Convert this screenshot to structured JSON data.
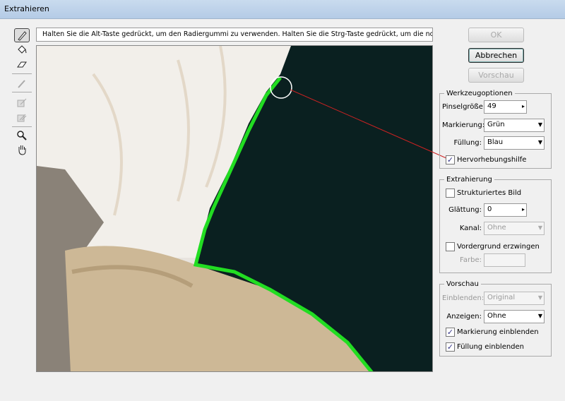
{
  "window": {
    "title": "Extrahieren"
  },
  "hint": "Halten Sie die Alt-Taste gedrückt, um den Radiergummi zu verwenden. Halten Sie die Strg-Taste gedrückt, um die normale Her",
  "tools": [
    "edge-highlighter",
    "fill",
    "eraser",
    "eyedropper",
    "cleanup",
    "edge-touchup",
    "zoom",
    "hand"
  ],
  "buttons": {
    "ok": "OK",
    "cancel": "Abbrechen",
    "preview": "Vorschau"
  },
  "tool_options": {
    "legend": "Werkzeugoptionen",
    "brush_size_label": "Pinselgröße:",
    "brush_size": "49",
    "highlight_label": "Markierung:",
    "highlight": "Grün",
    "fill_label": "Füllung:",
    "fill": "Blau",
    "smart_highlight_label": "Hervorhebungshilfe",
    "smart_highlight": true
  },
  "extraction": {
    "legend": "Extrahierung",
    "textured_label": "Strukturiertes Bild",
    "textured": false,
    "smooth_label": "Glättung:",
    "smooth": "0",
    "channel_label": "Kanal:",
    "channel": "Ohne",
    "force_fg_label": "Vordergrund erzwingen",
    "force_fg": false,
    "color_label": "Farbe:"
  },
  "preview": {
    "legend": "Vorschau",
    "show_label": "Einblenden:",
    "show": "Original",
    "display_label": "Anzeigen:",
    "display": "Ohne",
    "show_highlight_label": "Markierung einblenden",
    "show_highlight": true,
    "show_fill_label": "Füllung einblenden",
    "show_fill": true
  },
  "colors": {
    "highlight": "#22dd22",
    "fill": "#0a2020",
    "annotation": "#cc2222"
  }
}
